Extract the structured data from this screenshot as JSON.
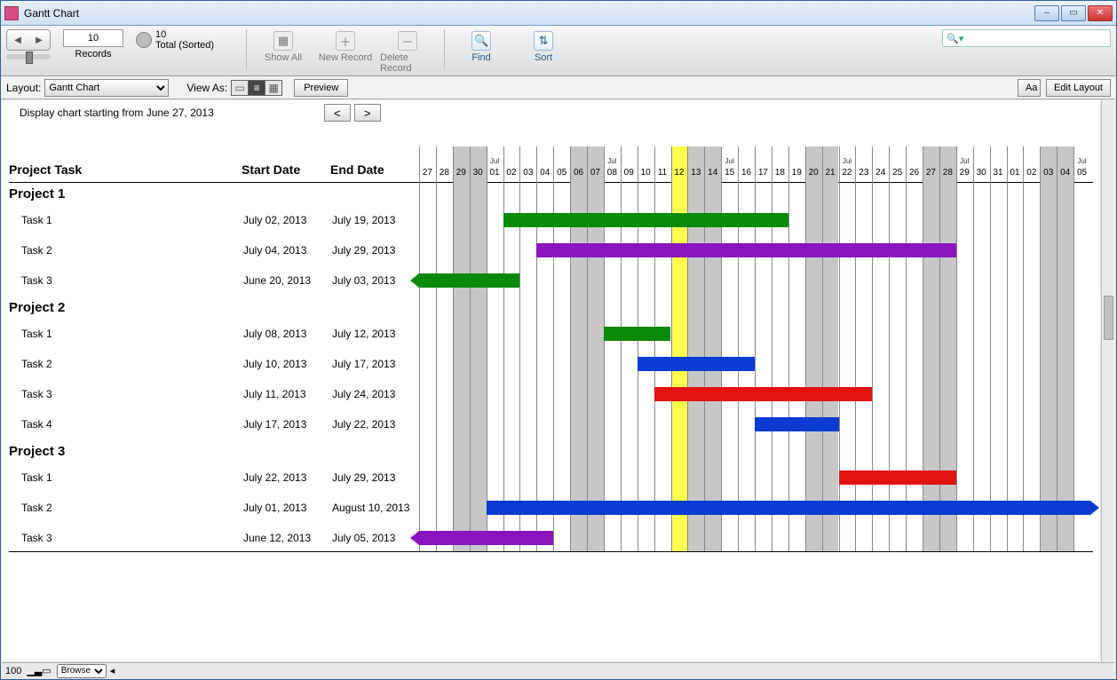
{
  "window": {
    "title": "Gantt Chart"
  },
  "toolbar": {
    "records_value": "10",
    "records_label": "Records",
    "total_count": "10",
    "total_label": "Total (Sorted)",
    "show_all": "Show All",
    "new_record": "New Record",
    "delete_record": "Delete Record",
    "find": "Find",
    "sort": "Sort"
  },
  "layoutbar": {
    "layout_label": "Layout:",
    "layout_value": "Gantt Chart",
    "view_as": "View As:",
    "preview": "Preview",
    "aa": "Aa",
    "edit_layout": "Edit Layout"
  },
  "filter": {
    "text": "Display chart starting from June 27, 2013",
    "prev": "<",
    "next": ">"
  },
  "headers": {
    "task": "Project Task",
    "start": "Start Date",
    "end": "End Date"
  },
  "status": {
    "zoom": "100",
    "mode": "Browse"
  },
  "chart_data": {
    "type": "gantt",
    "title": "Gantt Chart",
    "date_origin": "2013-06-27",
    "visible_days": 40,
    "today": "2013-07-12",
    "day_labels": [
      "27",
      "28",
      "29",
      "30",
      "01",
      "02",
      "03",
      "04",
      "05",
      "06",
      "07",
      "08",
      "09",
      "10",
      "11",
      "12",
      "13",
      "14",
      "15",
      "16",
      "17",
      "18",
      "19",
      "20",
      "21",
      "22",
      "23",
      "24",
      "25",
      "26",
      "27",
      "28",
      "29",
      "30",
      "31",
      "01",
      "02",
      "03",
      "04",
      "05"
    ],
    "month_markers": [
      {
        "idx": 4,
        "label": "Jul"
      },
      {
        "idx": 11,
        "label": "Jul"
      },
      {
        "idx": 18,
        "label": "Jul"
      },
      {
        "idx": 25,
        "label": "Jul"
      },
      {
        "idx": 32,
        "label": "Jul"
      },
      {
        "idx": 39,
        "label": "Jul"
      }
    ],
    "weekend_idx": [
      2,
      3,
      9,
      10,
      16,
      17,
      23,
      24,
      30,
      31,
      37,
      38
    ],
    "rows": [
      {
        "type": "project",
        "name": "Project 1"
      },
      {
        "type": "task",
        "name": "Task 1",
        "start": "July 02, 2013",
        "end": "July 19, 2013",
        "bar": {
          "from": 5,
          "to": 22,
          "color": "green"
        }
      },
      {
        "type": "task",
        "name": "Task 2",
        "start": "July 04, 2013",
        "end": "July 29, 2013",
        "bar": {
          "from": 7,
          "to": 32,
          "color": "purple"
        }
      },
      {
        "type": "task",
        "name": "Task 3",
        "start": "June 20, 2013",
        "end": "July 03, 2013",
        "bar": {
          "from": 0,
          "to": 6,
          "color": "green",
          "left_arrow": true
        }
      },
      {
        "type": "project",
        "name": "Project 2"
      },
      {
        "type": "task",
        "name": "Task 1",
        "start": "July 08, 2013",
        "end": "July 12, 2013",
        "bar": {
          "from": 11,
          "to": 15,
          "color": "green"
        }
      },
      {
        "type": "task",
        "name": "Task 2",
        "start": "July 10, 2013",
        "end": "July 17, 2013",
        "bar": {
          "from": 13,
          "to": 20,
          "color": "blue"
        }
      },
      {
        "type": "task",
        "name": "Task 3",
        "start": "July 11, 2013",
        "end": "July 24, 2013",
        "bar": {
          "from": 14,
          "to": 27,
          "color": "red"
        }
      },
      {
        "type": "task",
        "name": "Task 4",
        "start": "July 17, 2013",
        "end": "July 22, 2013",
        "bar": {
          "from": 20,
          "to": 25,
          "color": "blue"
        }
      },
      {
        "type": "project",
        "name": "Project 3"
      },
      {
        "type": "task",
        "name": "Task 1",
        "start": "July 22, 2013",
        "end": "July 29, 2013",
        "bar": {
          "from": 25,
          "to": 32,
          "color": "red"
        }
      },
      {
        "type": "task",
        "name": "Task 2",
        "start": "July 01, 2013",
        "end": "August 10, 2013",
        "bar": {
          "from": 4,
          "to": 40,
          "color": "blue",
          "right_arrow": true
        }
      },
      {
        "type": "task",
        "name": "Task 3",
        "start": "June 12, 2013",
        "end": "July 05, 2013",
        "bar": {
          "from": 0,
          "to": 8,
          "color": "purple",
          "left_arrow": true
        }
      }
    ]
  }
}
